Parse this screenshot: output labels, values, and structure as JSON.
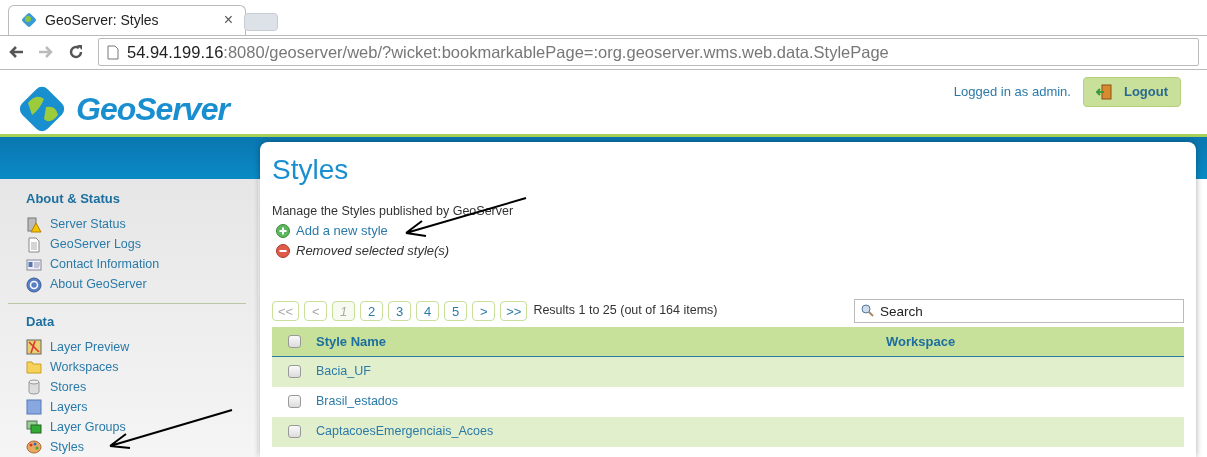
{
  "browser": {
    "tab_title": "GeoServer: Styles",
    "tab_close": "×",
    "url_host": "54.94.199.16",
    "url_rest": ":8080/geoserver/web/?wicket:bookmarkablePage=:org.geoserver.wms.web.data.StylePage"
  },
  "header": {
    "logo_text": "GeoServer",
    "login_text": "Logged in as admin.",
    "logout_label": "Logout"
  },
  "sidebar": {
    "sections": [
      {
        "title": "About & Status",
        "items": [
          {
            "label": "Server Status",
            "kind": "status"
          },
          {
            "label": "GeoServer Logs",
            "kind": "log"
          },
          {
            "label": "Contact Information",
            "kind": "contact"
          },
          {
            "label": "About GeoServer",
            "kind": "about"
          }
        ]
      },
      {
        "title": "Data",
        "items": [
          {
            "label": "Layer Preview",
            "kind": "preview"
          },
          {
            "label": "Workspaces",
            "kind": "folder"
          },
          {
            "label": "Stores",
            "kind": "store"
          },
          {
            "label": "Layers",
            "kind": "layer"
          },
          {
            "label": "Layer Groups",
            "kind": "groups"
          },
          {
            "label": "Styles",
            "kind": "palette"
          }
        ]
      }
    ]
  },
  "main": {
    "title": "Styles",
    "description": "Manage the Styles published by GeoServer",
    "actions": [
      {
        "label": "Add a new style",
        "kind": "add",
        "disabled": false
      },
      {
        "label": "Removed selected style(s)",
        "kind": "remove",
        "disabled": true
      }
    ],
    "pager": [
      {
        "label": "<<",
        "disabled": true,
        "selected": false
      },
      {
        "label": "<",
        "disabled": true,
        "selected": false
      },
      {
        "label": "1",
        "disabled": true,
        "selected": true
      },
      {
        "label": "2",
        "disabled": false,
        "selected": false
      },
      {
        "label": "3",
        "disabled": false,
        "selected": false
      },
      {
        "label": "4",
        "disabled": false,
        "selected": false
      },
      {
        "label": "5",
        "disabled": false,
        "selected": false
      },
      {
        "label": ">",
        "disabled": false,
        "selected": false
      },
      {
        "label": ">>",
        "disabled": false,
        "selected": false
      }
    ],
    "results": "Results 1 to 25 (out of 164 items)",
    "search": {
      "placeholder": "Search"
    },
    "table": {
      "columns": [
        "Style Name",
        "Workspace"
      ],
      "header_checked": false,
      "rows": [
        {
          "name": "Bacia_UF",
          "checked": false
        },
        {
          "name": "Brasil_estados",
          "checked": false
        },
        {
          "name": "CaptacoesEmergenciais_Acoes",
          "checked": false
        }
      ]
    }
  }
}
